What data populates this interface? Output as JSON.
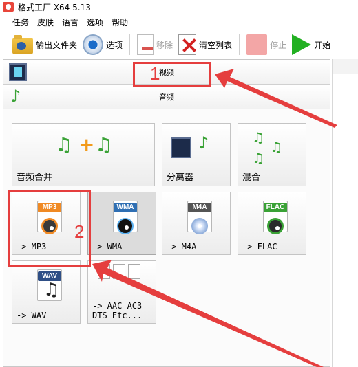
{
  "window": {
    "title": "格式工厂 X64 5.13"
  },
  "menu": {
    "items": [
      "任务",
      "皮肤",
      "语言",
      "选项",
      "帮助"
    ]
  },
  "toolbar": {
    "output_folder": "输出文件夹",
    "options": "选项",
    "remove": "移除",
    "clear_list": "清空列表",
    "stop": "停止",
    "start": "开始"
  },
  "categories": {
    "video": "视频",
    "audio": "音频"
  },
  "tiles": {
    "audio_merge": "音频合并",
    "splitter": "分离器",
    "mix": "混合",
    "mp3": "-> MP3",
    "wma": "-> WMA",
    "m4a": "-> M4A",
    "flac": "-> FLAC",
    "wav": "-> WAV",
    "aac_ac3": "-> AAC AC3\nDTS Etc..."
  },
  "badges": {
    "mp3": "MP3",
    "wma": "WMA",
    "m4a": "M4A",
    "flac": "FLAC",
    "wav": "WAV"
  },
  "annotations": {
    "first": "1",
    "second": "2"
  },
  "colors": {
    "accent_red": "#e53e3e",
    "start_green": "#22b022",
    "audio_green": "#3aa236"
  }
}
